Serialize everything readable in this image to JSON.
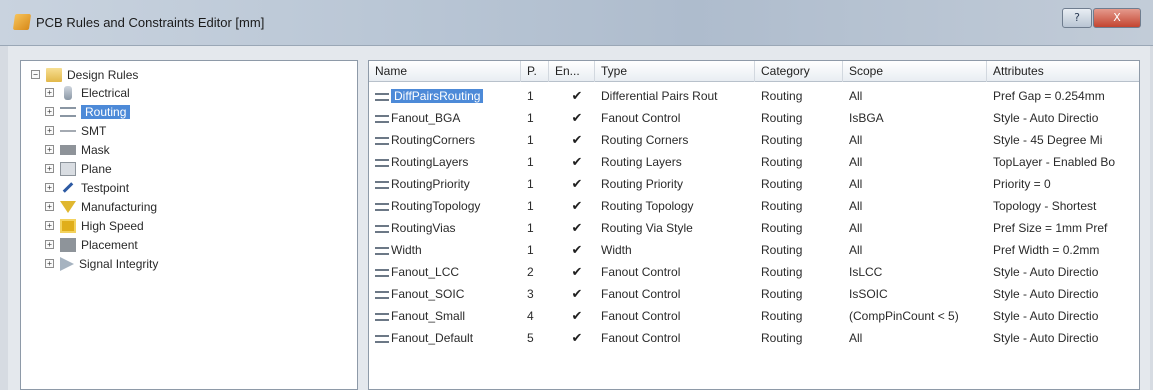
{
  "window": {
    "title": "PCB Rules and Constraints Editor [mm]",
    "help_label": "?",
    "close_label": "X"
  },
  "tree": {
    "root": "Design Rules",
    "items": [
      {
        "label": "Electrical",
        "icon": "electrical-icon"
      },
      {
        "label": "Routing",
        "icon": "routing-icon",
        "selected": true
      },
      {
        "label": "SMT",
        "icon": "smt-icon"
      },
      {
        "label": "Mask",
        "icon": "mask-icon"
      },
      {
        "label": "Plane",
        "icon": "plane-icon"
      },
      {
        "label": "Testpoint",
        "icon": "testpoint-icon"
      },
      {
        "label": "Manufacturing",
        "icon": "manufacturing-icon"
      },
      {
        "label": "High Speed",
        "icon": "high-speed-icon"
      },
      {
        "label": "Placement",
        "icon": "placement-icon"
      },
      {
        "label": "Signal Integrity",
        "icon": "signal-integrity-icon"
      }
    ]
  },
  "grid": {
    "columns": [
      "Name",
      "P.",
      "En...",
      "Type",
      "Category",
      "Scope",
      "Attributes"
    ],
    "rows": [
      {
        "name": "DiffPairsRouting",
        "priority": "1",
        "enabled": "✔",
        "type": "Differential Pairs Rout",
        "category": "Routing",
        "scope": "All",
        "attributes": "Pref Gap = 0.254mm"
      },
      {
        "name": "Fanout_BGA",
        "priority": "1",
        "enabled": "✔",
        "type": "Fanout Control",
        "category": "Routing",
        "scope": "IsBGA",
        "attributes": "Style - Auto  Directio"
      },
      {
        "name": "RoutingCorners",
        "priority": "1",
        "enabled": "✔",
        "type": "Routing Corners",
        "category": "Routing",
        "scope": "All",
        "attributes": "Style - 45 Degree  Mi"
      },
      {
        "name": "RoutingLayers",
        "priority": "1",
        "enabled": "✔",
        "type": "Routing Layers",
        "category": "Routing",
        "scope": "All",
        "attributes": "TopLayer - Enabled Bo"
      },
      {
        "name": "RoutingPriority",
        "priority": "1",
        "enabled": "✔",
        "type": "Routing Priority",
        "category": "Routing",
        "scope": "All",
        "attributes": "Priority = 0"
      },
      {
        "name": "RoutingTopology",
        "priority": "1",
        "enabled": "✔",
        "type": "Routing Topology",
        "category": "Routing",
        "scope": "All",
        "attributes": "Topology - Shortest"
      },
      {
        "name": "RoutingVias",
        "priority": "1",
        "enabled": "✔",
        "type": "Routing Via Style",
        "category": "Routing",
        "scope": "All",
        "attributes": "Pref Size = 1mm  Pref"
      },
      {
        "name": "Width",
        "priority": "1",
        "enabled": "✔",
        "type": "Width",
        "category": "Routing",
        "scope": "All",
        "attributes": "Pref Width = 0.2mm"
      },
      {
        "name": "Fanout_LCC",
        "priority": "2",
        "enabled": "✔",
        "type": "Fanout Control",
        "category": "Routing",
        "scope": "IsLCC",
        "attributes": "Style - Auto  Directio"
      },
      {
        "name": "Fanout_SOIC",
        "priority": "3",
        "enabled": "✔",
        "type": "Fanout Control",
        "category": "Routing",
        "scope": "IsSOIC",
        "attributes": "Style - Auto  Directio"
      },
      {
        "name": "Fanout_Small",
        "priority": "4",
        "enabled": "✔",
        "type": "Fanout Control",
        "category": "Routing",
        "scope": "(CompPinCount < 5)",
        "attributes": "Style - Auto  Directio"
      },
      {
        "name": "Fanout_Default",
        "priority": "5",
        "enabled": "✔",
        "type": "Fanout Control",
        "category": "Routing",
        "scope": "All",
        "attributes": "Style - Auto  Directio"
      }
    ]
  }
}
